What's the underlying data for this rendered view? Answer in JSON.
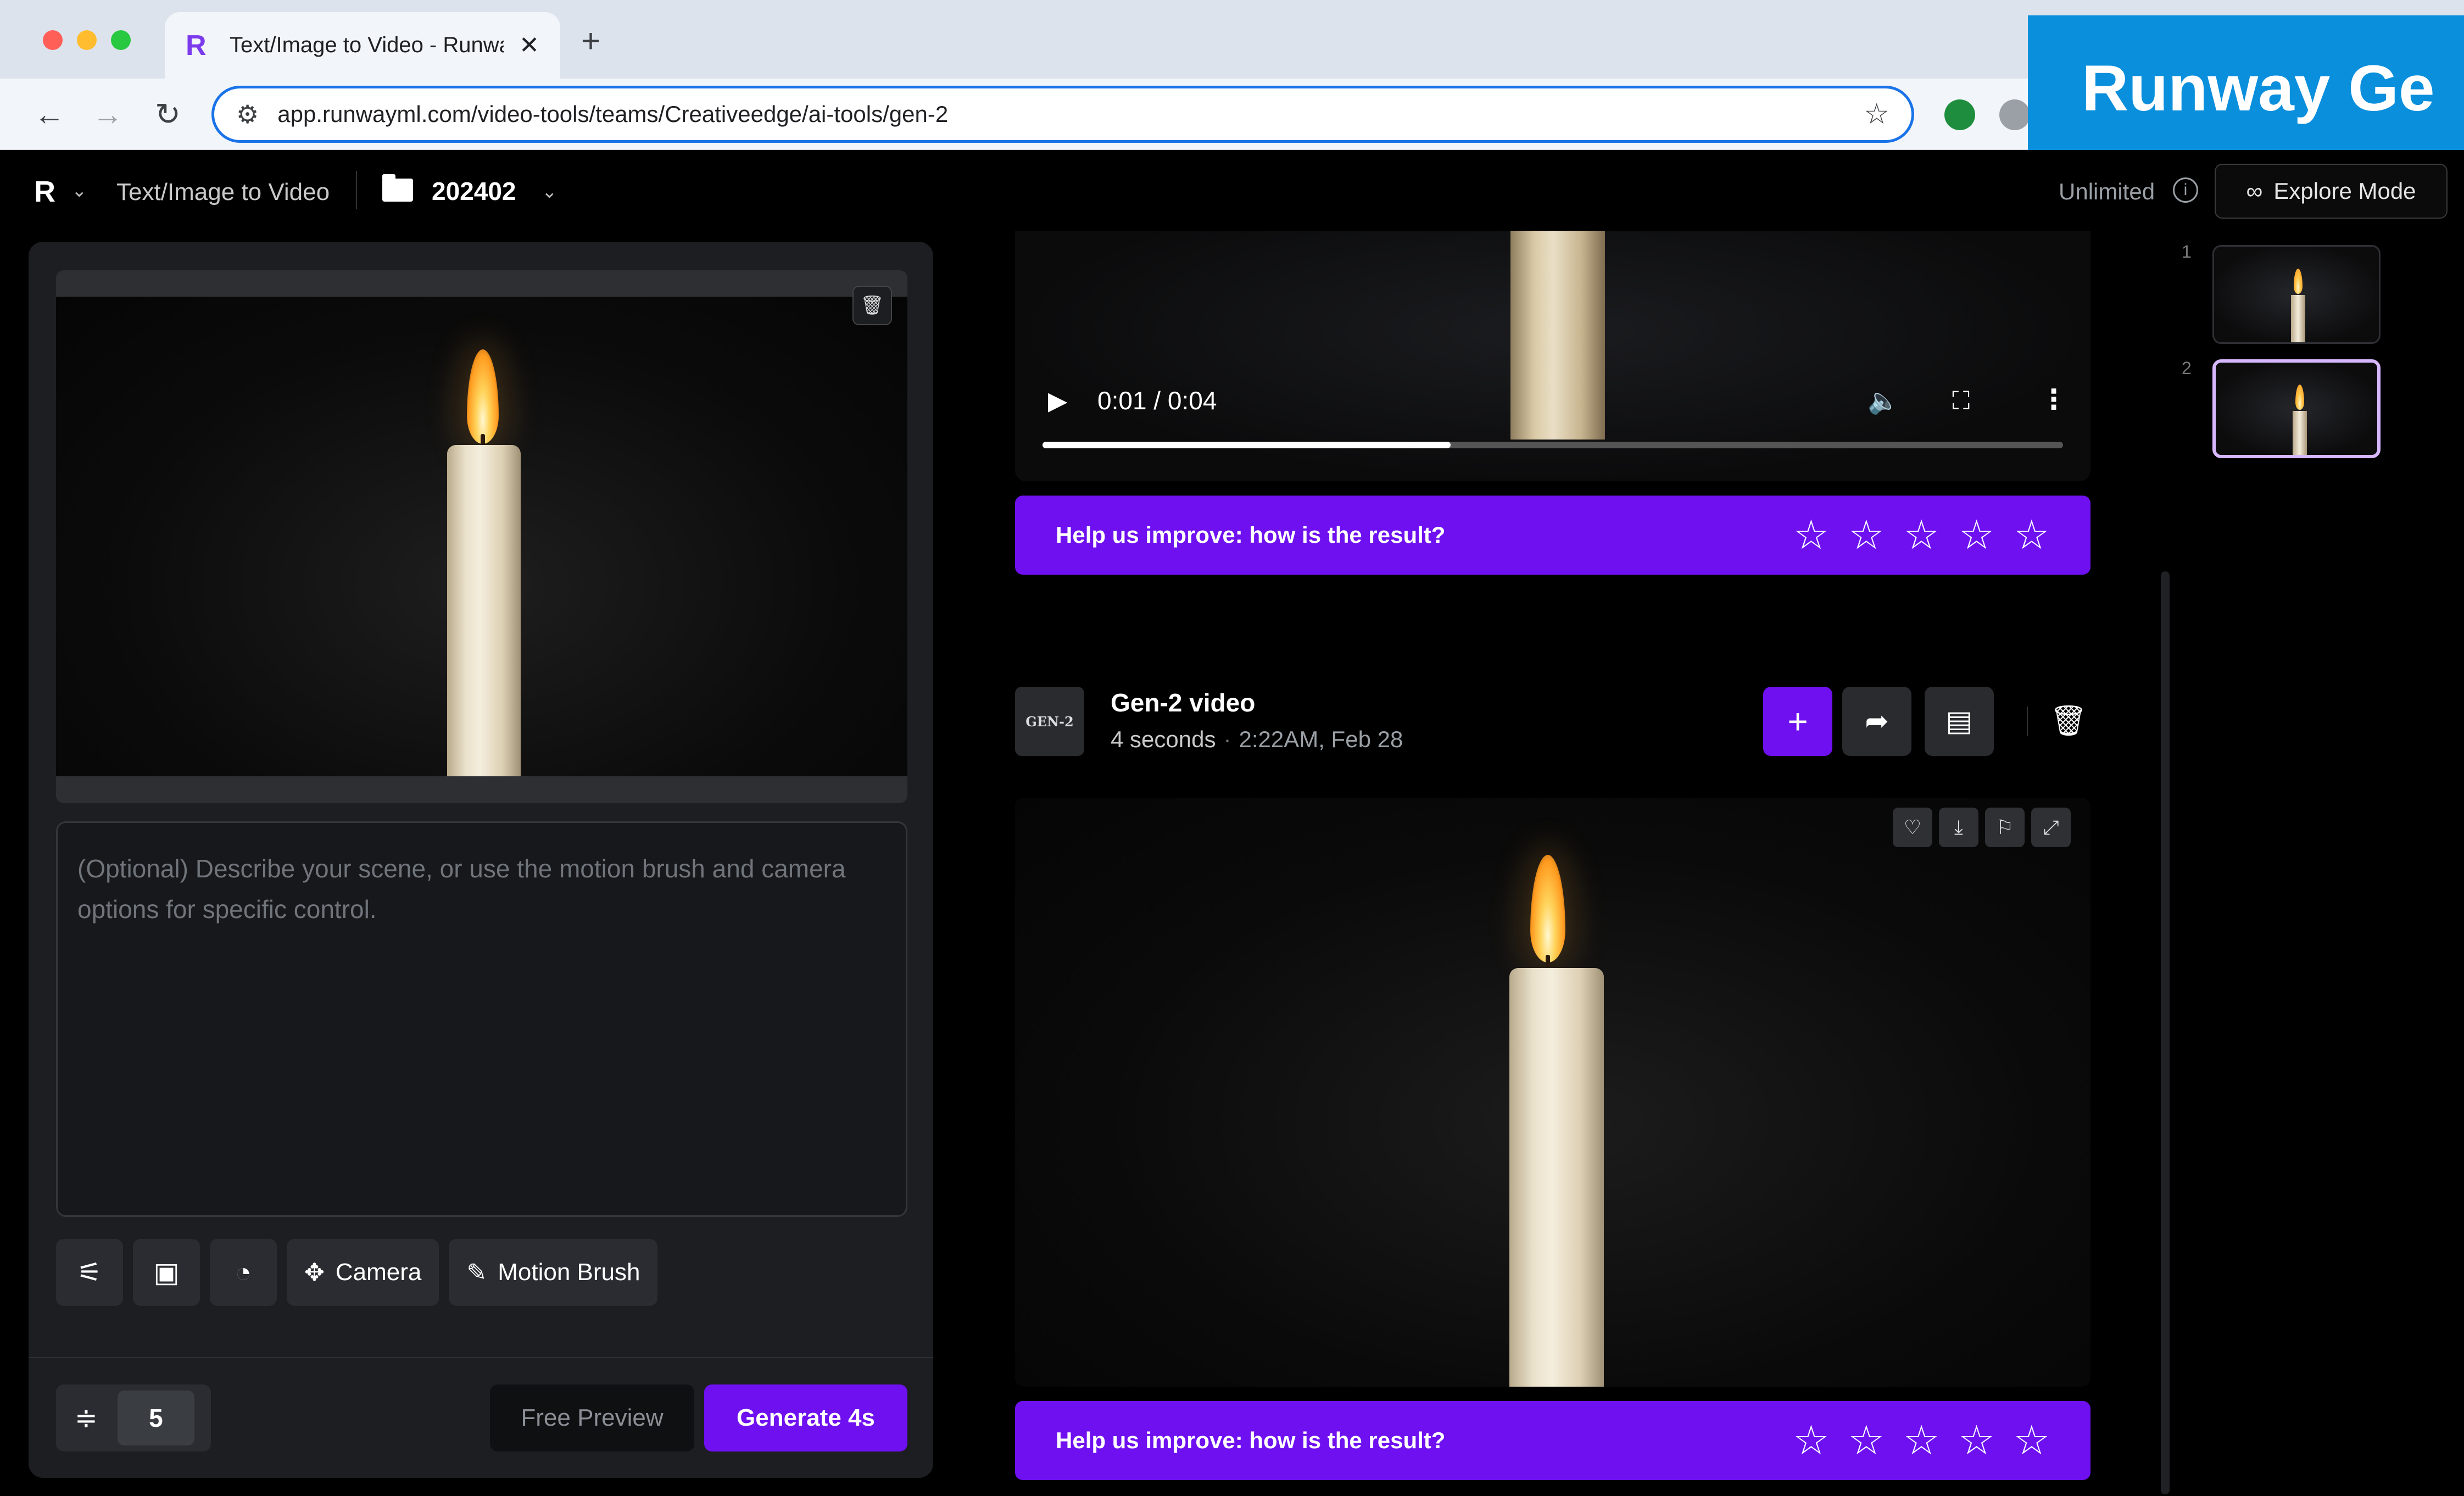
{
  "browser": {
    "tab_title": "Text/Image to Video - Runway",
    "tab_close": "✕",
    "new_tab": "+",
    "url": "app.runwayml.com/video-tools/teams/Creativeedge/ai-tools/gen-2",
    "traffic_colors": [
      "#ff5f57",
      "#febc2e",
      "#28c840"
    ]
  },
  "overlay": {
    "title": "Runway Ge"
  },
  "header": {
    "breadcrumb": "Text/Image to Video",
    "folder": "202402",
    "plan": "Unlimited",
    "info": "i",
    "explore_icon": "∞",
    "explore_label": "Explore Mode"
  },
  "left_panel": {
    "prompt_placeholder": "(Optional) Describe your scene, or use the motion brush and camera options for specific control.",
    "camera_label": "Camera",
    "motion_brush_label": "Motion Brush",
    "duration_value": "5",
    "free_preview_label": "Free Preview",
    "generate_label": "Generate 4s"
  },
  "top_video": {
    "time": "0:01 / 0:04",
    "progress": 0.4
  },
  "feedback": {
    "text": "Help us improve: how is the result?",
    "star": "☆"
  },
  "generation": {
    "thumb_label": "GEN-2",
    "title": "Gen-2 video",
    "duration": "4 seconds",
    "timestamp": "2:22AM, Feb 28"
  },
  "thumbnails": {
    "numbers": [
      "1",
      "2"
    ]
  },
  "colors": {
    "accent": "#6e10f0",
    "overlay": "#0a8fdc"
  }
}
